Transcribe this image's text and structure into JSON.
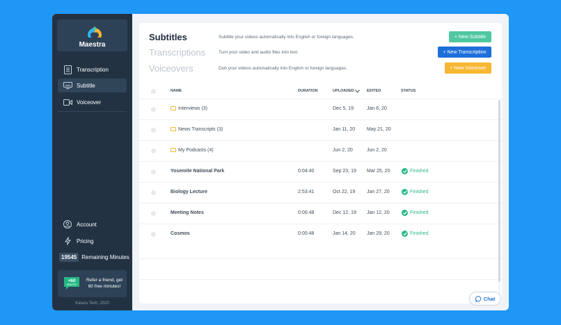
{
  "app": {
    "name": "Maestra",
    "copyright": "Katara Tech, 2020"
  },
  "sidebar": {
    "items": [
      {
        "label": "Transcription",
        "icon": "document-icon"
      },
      {
        "label": "Subtitle",
        "icon": "subtitle-icon",
        "active": true
      },
      {
        "label": "Voiceover",
        "icon": "camera-icon"
      }
    ],
    "bottom": [
      {
        "label": "Account",
        "icon": "user-icon"
      },
      {
        "label": "Pricing",
        "icon": "bolt-icon"
      }
    ],
    "remaining": {
      "count": "19545",
      "label": "Remaining Minutes"
    },
    "refer": {
      "badge_top": "+60",
      "badge_bottom": "MINUTES",
      "text": "Refer a friend, get 60 free minutes!"
    }
  },
  "header": {
    "sections": [
      {
        "title": "Subtitles",
        "desc": "Subtitle your videos automatically into English or foreign languages.",
        "button": "+  New Subtitle",
        "color": "#4fc7a0",
        "active": true
      },
      {
        "title": "Transcriptions",
        "desc": "Turn your video and audio files into text.",
        "button": "+  New Transcription",
        "color": "#1e6fd9",
        "active": false
      },
      {
        "title": "Voiceovers",
        "desc": "Dub your videos automatically into English or foreign languages.",
        "button": "+  New Voiceover",
        "color": "#f7b733",
        "active": false
      }
    ]
  },
  "table": {
    "columns": {
      "name": "NAME",
      "duration": "DURATION",
      "uploaded": "UPLOADED",
      "edited": "EDITED",
      "status": "STATUS"
    },
    "rows": [
      {
        "type": "folder",
        "name": "Interviews (3)",
        "duration": "",
        "uploaded": "Dec 5, 19",
        "edited": "Jan 6, 20",
        "status": ""
      },
      {
        "type": "folder",
        "name": "News Transcripts (3)",
        "duration": "",
        "uploaded": "Jan 11, 20",
        "edited": "May 21, 20",
        "status": ""
      },
      {
        "type": "folder",
        "name": "My Podcasts (4)",
        "duration": "",
        "uploaded": "Jun 2, 20",
        "edited": "Jun 2, 20",
        "status": ""
      },
      {
        "type": "file",
        "name": "Yosemite National Park",
        "duration": "0:04:40",
        "uploaded": "Sep 23, 19",
        "edited": "Mar 25, 20",
        "status": "Finished"
      },
      {
        "type": "file",
        "name": "Biology Lecture",
        "duration": "2:53:41",
        "uploaded": "Oct 22, 19",
        "edited": "Jan 27, 20",
        "status": "Finished"
      },
      {
        "type": "file",
        "name": "Meeting Notes",
        "duration": "0:00:48",
        "uploaded": "Dec 12, 19",
        "edited": "Jan 12, 20",
        "status": "Finished"
      },
      {
        "type": "file",
        "name": "Cosmos",
        "duration": "0:00:48",
        "uploaded": "Jan 14, 20",
        "edited": "Jan 29, 20",
        "status": "Finished"
      }
    ]
  },
  "chat": {
    "label": "Chat"
  },
  "colors": {
    "background": "#1e97f6",
    "sidebar": "#223243",
    "finished": "#27b883"
  }
}
